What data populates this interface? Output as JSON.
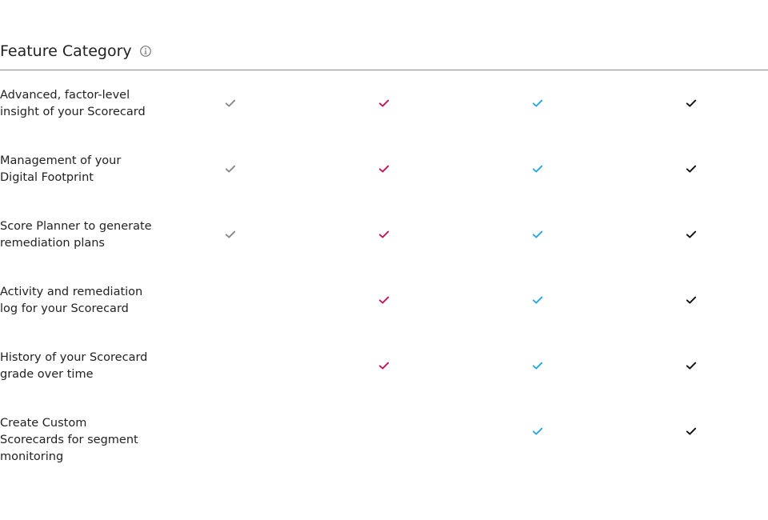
{
  "header": {
    "title": "Feature Category",
    "info_icon": "info-circle-icon"
  },
  "plan_colors": [
    "#8a8a8a",
    "#c2185b",
    "#2aa7e0",
    "#111111"
  ],
  "check_icon": "check-icon",
  "features": [
    {
      "label": "Advanced, factor-level insight of your Scorecard",
      "included": [
        true,
        true,
        true,
        true
      ]
    },
    {
      "label": "Management of your Digital Footprint",
      "included": [
        true,
        true,
        true,
        true
      ]
    },
    {
      "label": "Score Planner to generate remediation plans",
      "included": [
        true,
        true,
        true,
        true
      ]
    },
    {
      "label": "Activity and remediation log for your Scorecard",
      "included": [
        false,
        true,
        true,
        true
      ]
    },
    {
      "label": "History of your Scorecard grade over time",
      "included": [
        false,
        true,
        true,
        true
      ]
    },
    {
      "label": "Create Custom Scorecards for segment monitoring",
      "included": [
        false,
        false,
        true,
        true
      ]
    }
  ]
}
